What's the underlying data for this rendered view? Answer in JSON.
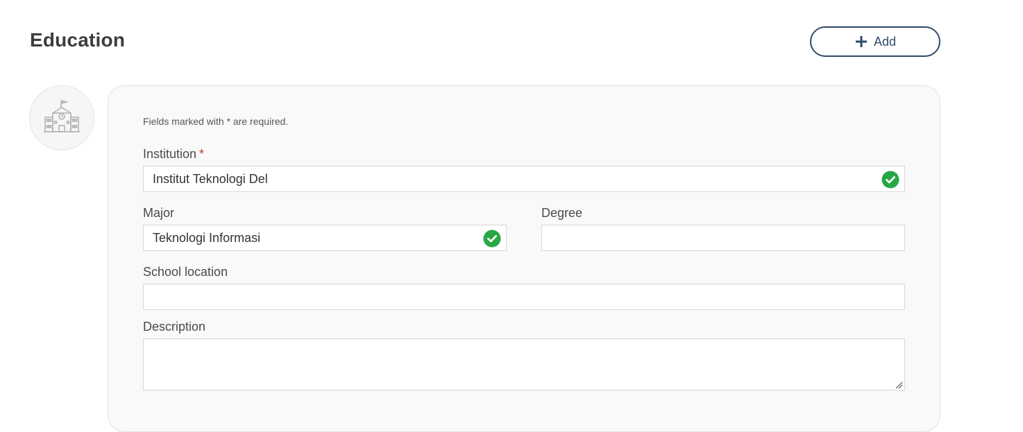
{
  "section": {
    "title": "Education",
    "add_label": "Add"
  },
  "form": {
    "required_note": "Fields marked with * are required.",
    "required_marker": "*",
    "institution": {
      "label": "Institution",
      "value": "Institut Teknologi Del",
      "valid": true
    },
    "major": {
      "label": "Major",
      "value": "Teknologi Informasi",
      "valid": true
    },
    "degree": {
      "label": "Degree",
      "value": ""
    },
    "school_location": {
      "label": "School location",
      "value": ""
    },
    "description": {
      "label": "Description",
      "value": ""
    }
  },
  "icons": {
    "add": "plus-icon",
    "avatar": "school-building-icon",
    "valid": "check-circle-icon"
  },
  "colors": {
    "accent": "#2f4a68",
    "valid": "#27a844",
    "required": "#c0392b",
    "card_bg": "#f9f9f9"
  }
}
